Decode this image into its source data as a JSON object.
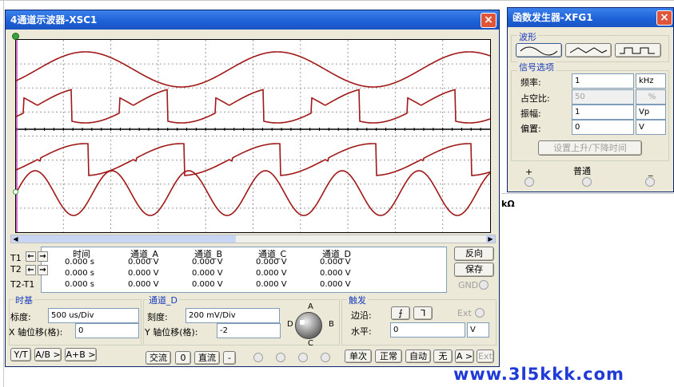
{
  "scope": {
    "title": "4通道示波器-XSC1",
    "close": "×",
    "table": {
      "headers": [
        "时间",
        "通道_A",
        "通道_B",
        "通道_C",
        "通道_D"
      ],
      "row_labels": [
        "T1",
        "T2",
        "T2-T1"
      ],
      "rows": [
        [
          "0.000 s",
          "0.000 V",
          "0.000 V",
          "0.000 V",
          "0.000 V"
        ],
        [
          "0.000 s",
          "0.000 V",
          "0.000 V",
          "0.000 V",
          "0.000 V"
        ],
        [
          "0.000 s",
          "0.000 V",
          "0.000 V",
          "0.000 V",
          "0.000 V"
        ]
      ]
    },
    "reverse_label": "反向",
    "save_label": "保存",
    "gnd_label": "GND",
    "timebase": {
      "title": "时基",
      "scale_label": "标度:",
      "scale_value": "500 us/Div",
      "xpos_label": "X 轴位移(格):",
      "xpos_value": "0",
      "mode_buttons": [
        "Y/T",
        "A/B >",
        "A+B >"
      ]
    },
    "channel": {
      "title": "通道_D",
      "scale_label": "刻度:",
      "scale_value": "200 mV/Div",
      "ypos_label": "Y 轴位移(格):",
      "ypos_value": "-2",
      "coupling_buttons": [
        "交流",
        "0",
        "直流",
        "-"
      ],
      "knob_labels": [
        "A",
        "B",
        "C",
        "D"
      ]
    },
    "trigger": {
      "title": "触发",
      "edge_label": "边沿:",
      "edge_rise": "⨍",
      "edge_fall": "ᒣ",
      "ext_label": "Ext",
      "level_label": "水平:",
      "level_value": "0",
      "level_unit": "V",
      "mode_buttons": [
        "单次",
        "正常",
        "自动",
        "无",
        "A >",
        "Ext"
      ]
    }
  },
  "fgen": {
    "title": "函数发生器-XFG1",
    "close": "×",
    "waveform_title": "波形",
    "signal_title": "信号选项",
    "freq_label": "频率:",
    "freq_value": "1",
    "freq_unit": "kHz",
    "duty_label": "占空比:",
    "duty_value": "50",
    "duty_unit": "%",
    "amp_label": "振幅:",
    "amp_value": "1",
    "amp_unit": "Vp",
    "offset_label": "偏置:",
    "offset_value": "0",
    "offset_unit": "V",
    "rise_fall_button": "设置上升/下降时间",
    "plus": "+",
    "common": "普通",
    "minus": "_"
  },
  "background": {
    "kohm_fragment": "kΩ",
    "watermark": "www.3l5kkk.com"
  },
  "colors": {
    "title_blue": "#1c5fd6",
    "trace_red": "#a01818",
    "group_title": "#1a3cbc",
    "watermark_blue": "#1f3ad6"
  }
}
